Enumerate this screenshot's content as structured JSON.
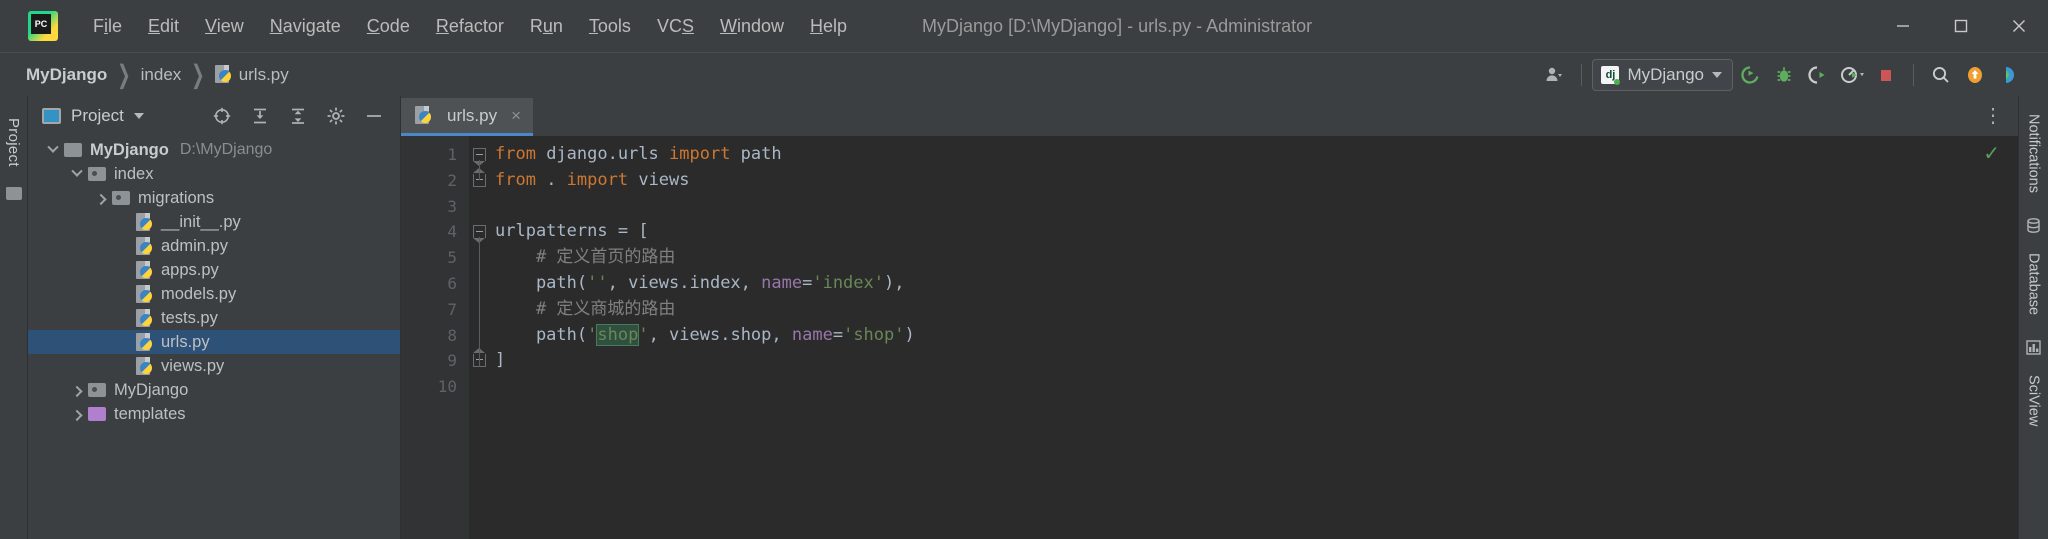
{
  "window": {
    "title": "MyDjango [D:\\MyDjango] - urls.py - Administrator",
    "minimize": "minimize-icon",
    "maximize": "maximize-icon",
    "close": "close-icon",
    "logo": "pycharm-logo"
  },
  "menu": [
    {
      "label": "File",
      "pre": "F",
      "mnem": "i",
      "post": "le"
    },
    {
      "label": "Edit",
      "pre": "",
      "mnem": "E",
      "post": "dit"
    },
    {
      "label": "View",
      "pre": "",
      "mnem": "V",
      "post": "iew"
    },
    {
      "label": "Navigate",
      "pre": "",
      "mnem": "N",
      "post": "avigate"
    },
    {
      "label": "Code",
      "pre": "",
      "mnem": "C",
      "post": "ode"
    },
    {
      "label": "Refactor",
      "pre": "",
      "mnem": "R",
      "post": "efactor"
    },
    {
      "label": "Run",
      "pre": "R",
      "mnem": "u",
      "post": "n"
    },
    {
      "label": "Tools",
      "pre": "",
      "mnem": "T",
      "post": "ools"
    },
    {
      "label": "VCS",
      "pre": "VC",
      "mnem": "S",
      "post": ""
    },
    {
      "label": "Window",
      "pre": "",
      "mnem": "W",
      "post": "indow"
    },
    {
      "label": "Help",
      "pre": "",
      "mnem": "H",
      "post": "elp"
    }
  ],
  "breadcrumb": [
    {
      "label": "MyDjango",
      "bold": true,
      "icon": null
    },
    {
      "label": "index",
      "bold": false,
      "icon": null
    },
    {
      "label": "urls.py",
      "bold": false,
      "icon": "python-file-icon"
    }
  ],
  "toolbar": {
    "user_icon": "user-account-icon",
    "run_config": {
      "icon": "django-icon",
      "icon_text": "dj",
      "label": "MyDjango"
    },
    "buttons": [
      {
        "name": "run-button",
        "icon": "run-icon",
        "color": "#5fad5f"
      },
      {
        "name": "debug-button",
        "icon": "debug-bug-icon",
        "color": "#5fad5f"
      },
      {
        "name": "run-coverage-button",
        "icon": "coverage-icon",
        "color": "#d6d6d6"
      },
      {
        "name": "profile-button",
        "icon": "profiler-icon",
        "color": "#5fad5f"
      },
      {
        "name": "stop-button",
        "icon": "stop-square-icon",
        "color": "#cc5555"
      },
      {
        "name": "search-button",
        "icon": "search-icon",
        "color": "#b0b3b5"
      },
      {
        "name": "update-button",
        "icon": "update-arrow-icon",
        "color": "#f0a030"
      },
      {
        "name": "ide-feature-button",
        "icon": "colored-droplet-icon",
        "color": "#3a9ad9"
      }
    ]
  },
  "left_strip": {
    "tab": "Project",
    "folder_icon": "folder-icon"
  },
  "project_panel": {
    "title": "Project",
    "dropdown_icon": "chevron-down-icon",
    "actions": [
      {
        "name": "locate-file-button",
        "icon": "crosshair-target-icon"
      },
      {
        "name": "expand-all-button",
        "icon": "expand-all-icon"
      },
      {
        "name": "collapse-all-button",
        "icon": "collapse-all-icon"
      },
      {
        "name": "settings-button",
        "icon": "gear-icon"
      },
      {
        "name": "hide-panel-button",
        "icon": "minus-icon"
      }
    ],
    "tree": [
      {
        "label": "MyDjango",
        "path": "D:\\MyDjango",
        "indent": 0,
        "twisty": "down",
        "icon": "folder",
        "bold": true,
        "selected": false
      },
      {
        "label": "index",
        "path": "",
        "indent": 1,
        "twisty": "down",
        "icon": "folder-source",
        "bold": false,
        "selected": false
      },
      {
        "label": "migrations",
        "path": "",
        "indent": 2,
        "twisty": "right",
        "icon": "folder-source",
        "bold": false,
        "selected": false
      },
      {
        "label": "__init__.py",
        "path": "",
        "indent": 3,
        "twisty": "none",
        "icon": "python",
        "bold": false,
        "selected": false
      },
      {
        "label": "admin.py",
        "path": "",
        "indent": 3,
        "twisty": "none",
        "icon": "python",
        "bold": false,
        "selected": false
      },
      {
        "label": "apps.py",
        "path": "",
        "indent": 3,
        "twisty": "none",
        "icon": "python",
        "bold": false,
        "selected": false
      },
      {
        "label": "models.py",
        "path": "",
        "indent": 3,
        "twisty": "none",
        "icon": "python",
        "bold": false,
        "selected": false
      },
      {
        "label": "tests.py",
        "path": "",
        "indent": 3,
        "twisty": "none",
        "icon": "python",
        "bold": false,
        "selected": false
      },
      {
        "label": "urls.py",
        "path": "",
        "indent": 3,
        "twisty": "none",
        "icon": "python",
        "bold": false,
        "selected": true
      },
      {
        "label": "views.py",
        "path": "",
        "indent": 3,
        "twisty": "none",
        "icon": "python",
        "bold": false,
        "selected": false
      },
      {
        "label": "MyDjango",
        "path": "",
        "indent": 1,
        "twisty": "right",
        "icon": "folder-source",
        "bold": false,
        "selected": false
      },
      {
        "label": "templates",
        "path": "",
        "indent": 1,
        "twisty": "right",
        "icon": "folder-template",
        "bold": false,
        "selected": false
      }
    ]
  },
  "editor": {
    "tab": {
      "label": "urls.py",
      "icon": "python-file-icon",
      "close": "×"
    },
    "options_icon": "more-options-icon",
    "inspection_status": "✓",
    "line_numbers": [
      "1",
      "2",
      "3",
      "4",
      "5",
      "6",
      "7",
      "8",
      "9",
      "10"
    ],
    "lines": [
      {
        "n": 1,
        "fold": "start",
        "tokens": [
          {
            "t": "from",
            "c": "kw"
          },
          {
            "t": " django.urls ",
            "c": "id"
          },
          {
            "t": "import",
            "c": "kw"
          },
          {
            "t": " path",
            "c": "id"
          }
        ]
      },
      {
        "n": 2,
        "fold": "end",
        "tokens": [
          {
            "t": "from",
            "c": "kw"
          },
          {
            "t": " . ",
            "c": "id"
          },
          {
            "t": "import",
            "c": "kw"
          },
          {
            "t": " views",
            "c": "id"
          }
        ]
      },
      {
        "n": 3,
        "fold": "none",
        "tokens": []
      },
      {
        "n": 4,
        "fold": "start",
        "tokens": [
          {
            "t": "urlpatterns",
            "c": "id"
          },
          {
            "t": " = ",
            "c": "op"
          },
          {
            "t": "[",
            "c": "op"
          }
        ]
      },
      {
        "n": 5,
        "fold": "none",
        "tokens": [
          {
            "t": "    # 定义首页的路由",
            "c": "cm"
          }
        ]
      },
      {
        "n": 6,
        "fold": "none",
        "tokens": [
          {
            "t": "    path(",
            "c": "id"
          },
          {
            "t": "''",
            "c": "str"
          },
          {
            "t": ", views.index, ",
            "c": "id"
          },
          {
            "t": "name",
            "c": "pm"
          },
          {
            "t": "=",
            "c": "op"
          },
          {
            "t": "'index'",
            "c": "str"
          },
          {
            "t": "),",
            "c": "op"
          }
        ]
      },
      {
        "n": 7,
        "fold": "none",
        "tokens": [
          {
            "t": "    # 定义商城的路由",
            "c": "cm"
          }
        ]
      },
      {
        "n": 8,
        "fold": "none",
        "tokens": [
          {
            "t": "    path(",
            "c": "id"
          },
          {
            "t": "'",
            "c": "str"
          },
          {
            "t": "shop",
            "c": "str hl"
          },
          {
            "t": "'",
            "c": "str"
          },
          {
            "t": ", views.shop, ",
            "c": "id"
          },
          {
            "t": "name",
            "c": "pm"
          },
          {
            "t": "=",
            "c": "op"
          },
          {
            "t": "'shop'",
            "c": "str"
          },
          {
            "t": ")",
            "c": "op"
          }
        ]
      },
      {
        "n": 9,
        "fold": "end",
        "tokens": [
          {
            "t": "]",
            "c": "op"
          }
        ]
      },
      {
        "n": 10,
        "fold": "none",
        "tokens": []
      }
    ]
  },
  "right_strip": {
    "tabs": [
      "Notifications",
      "Database",
      "SciView"
    ],
    "icons": [
      "database-icon",
      "sciview-icon"
    ]
  }
}
